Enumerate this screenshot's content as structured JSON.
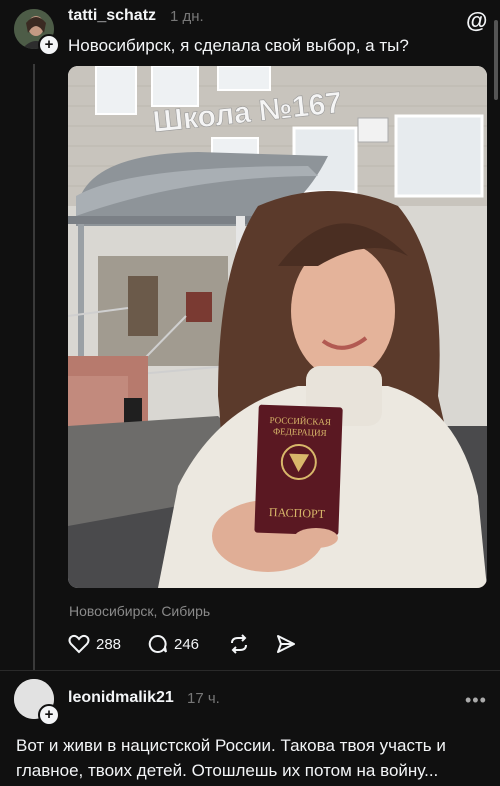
{
  "post": {
    "username": "tatti_schatz",
    "time": "1 дн.",
    "text": "Новосибирск, я сделала свой выбор, а ты?",
    "photo": {
      "sign_text": "Школа №167",
      "passport_line1": "РОССИЙСКАЯ",
      "passport_line2": "ФЕДЕРАЦИЯ",
      "passport_title": "ПАСПОРТ"
    },
    "location": "Новосибирск, Сибирь",
    "likes": "288",
    "comments": "246"
  },
  "reply": {
    "username": "leonidmalik21",
    "time": "17 ч.",
    "text": "Вот и живи в нацистской России. Такова твоя участь и главное, твоих детей. Отошлешь их потом на войну..."
  },
  "icons": {
    "app_logo": "threads-logo-icon",
    "like": "heart-icon",
    "comment": "comment-bubble-icon",
    "repost": "repost-icon",
    "share": "send-icon",
    "follow": "plus-icon",
    "more": "more-dots-icon"
  },
  "colors": {
    "background": "#101010",
    "text": "#f3f5f7",
    "muted": "#777777"
  }
}
